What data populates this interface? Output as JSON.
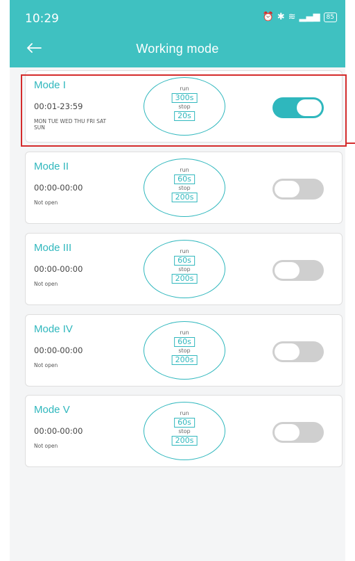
{
  "status_bar": {
    "time": "10:29",
    "battery": "85"
  },
  "header": {
    "title": "Working mode"
  },
  "timer_labels": {
    "run": "run",
    "stop": "stop"
  },
  "modes": [
    {
      "name": "Mode I",
      "time_range": "00:01-23:59",
      "days": "MON TUE WED THU FRI SAT SUN",
      "status": "",
      "run": "300s",
      "stop": "20s",
      "enabled": true
    },
    {
      "name": "Mode II",
      "time_range": "00:00-00:00",
      "days": "",
      "status": "Not open",
      "run": "60s",
      "stop": "200s",
      "enabled": false
    },
    {
      "name": "Mode III",
      "time_range": "00:00-00:00",
      "days": "",
      "status": "Not open",
      "run": "60s",
      "stop": "200s",
      "enabled": false
    },
    {
      "name": "Mode IV",
      "time_range": "00:00-00:00",
      "days": "",
      "status": "Not open",
      "run": "60s",
      "stop": "200s",
      "enabled": false
    },
    {
      "name": "Mode V",
      "time_range": "00:00-00:00",
      "days": "",
      "status": "Not open",
      "run": "60s",
      "stop": "200s",
      "enabled": false
    }
  ],
  "colors": {
    "accent": "#3fc1c1",
    "toggle_off": "#cfcfcf",
    "highlight": "#d42b2b"
  }
}
